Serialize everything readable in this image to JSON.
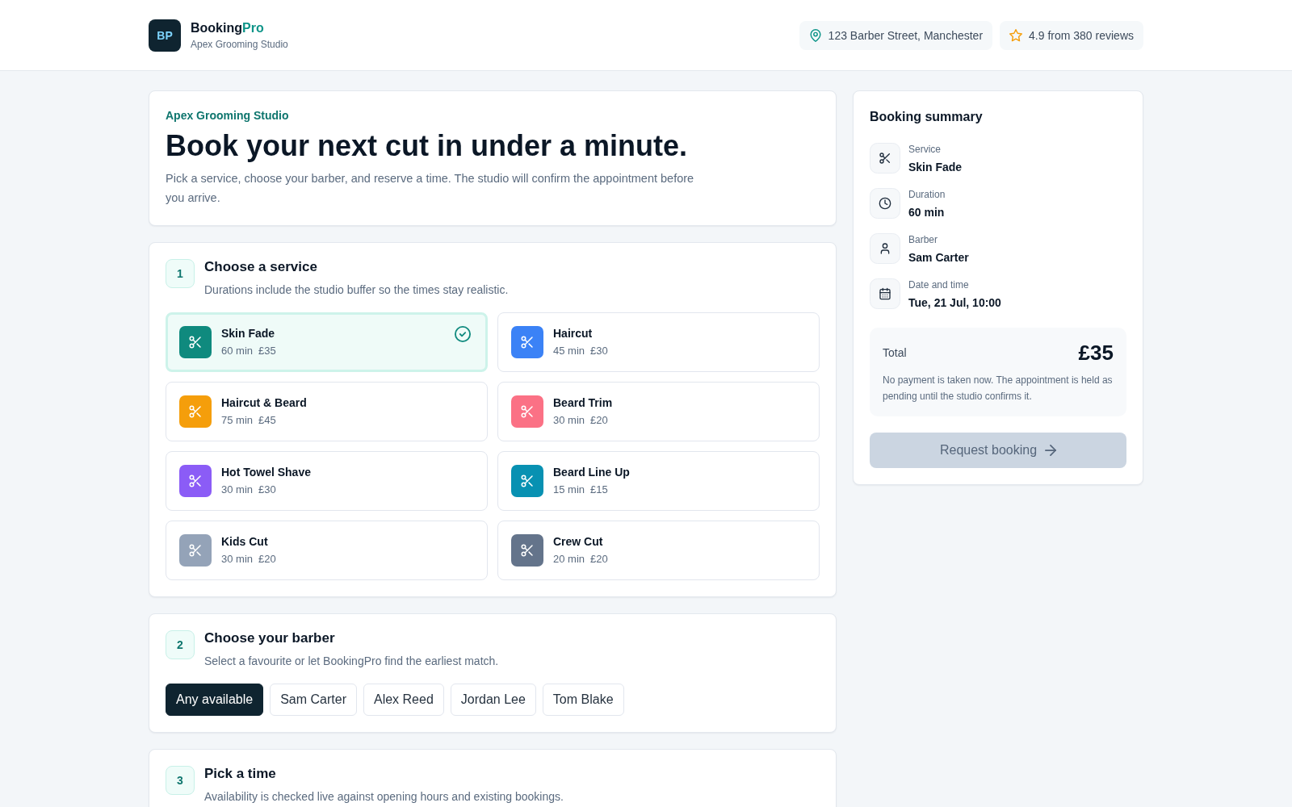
{
  "header": {
    "logo": "BP",
    "brand": "Booking",
    "brand_accent": "Pro",
    "subtitle": "Apex Grooming Studio",
    "location": "123 Barber Street, Manchester",
    "rating": "4.9 from 380 reviews"
  },
  "intro": {
    "eyebrow": "Apex Grooming Studio",
    "title": "Book your next cut in under a minute.",
    "text": "Pick a service, choose your barber, and reserve a time. The studio will confirm the appointment before you arrive."
  },
  "service_step": {
    "number": "1",
    "title": "Choose a service",
    "subtitle": "Durations include the studio buffer so the times stay realistic.",
    "services": [
      {
        "name": "Skin Fade",
        "duration": "60 min",
        "price": "£35",
        "color": "#0f8a7e",
        "selected": true
      },
      {
        "name": "Haircut",
        "duration": "45 min",
        "price": "£30",
        "color": "#3b82f6",
        "selected": false
      },
      {
        "name": "Haircut & Beard",
        "duration": "75 min",
        "price": "£45",
        "color": "#f59e0b",
        "selected": false
      },
      {
        "name": "Beard Trim",
        "duration": "30 min",
        "price": "£20",
        "color": "#fb7185",
        "selected": false
      },
      {
        "name": "Hot Towel Shave",
        "duration": "30 min",
        "price": "£30",
        "color": "#8b5cf6",
        "selected": false
      },
      {
        "name": "Beard Line Up",
        "duration": "15 min",
        "price": "£15",
        "color": "#0891b2",
        "selected": false
      },
      {
        "name": "Kids Cut",
        "duration": "30 min",
        "price": "£20",
        "color": "#94a3b8",
        "selected": false
      },
      {
        "name": "Crew Cut",
        "duration": "20 min",
        "price": "£20",
        "color": "#64748b",
        "selected": false
      }
    ]
  },
  "barber_step": {
    "number": "2",
    "title": "Choose your barber",
    "subtitle": "Select a favourite or let BookingPro find the earliest match.",
    "barbers": [
      {
        "label": "Any available",
        "selected": true
      },
      {
        "label": "Sam Carter",
        "selected": false
      },
      {
        "label": "Alex Reed",
        "selected": false
      },
      {
        "label": "Jordan Lee",
        "selected": false
      },
      {
        "label": "Tom Blake",
        "selected": false
      }
    ]
  },
  "time_step": {
    "number": "3",
    "title": "Pick a time",
    "subtitle": "Availability is checked live against opening hours and existing bookings."
  },
  "summary": {
    "title": "Booking summary",
    "rows": [
      {
        "kind": "service",
        "label": "Service",
        "value": "Skin Fade"
      },
      {
        "kind": "duration",
        "label": "Duration",
        "value": "60 min"
      },
      {
        "kind": "barber",
        "label": "Barber",
        "value": "Sam Carter"
      },
      {
        "kind": "datetime",
        "label": "Date and time",
        "value": "Tue, 21 Jul, 10:00"
      }
    ],
    "total_label": "Total",
    "total": "£35",
    "note": "No payment is taken now. The appointment is held as pending until the studio confirms it.",
    "button": {
      "label": "Request booking",
      "disabled": true
    }
  }
}
